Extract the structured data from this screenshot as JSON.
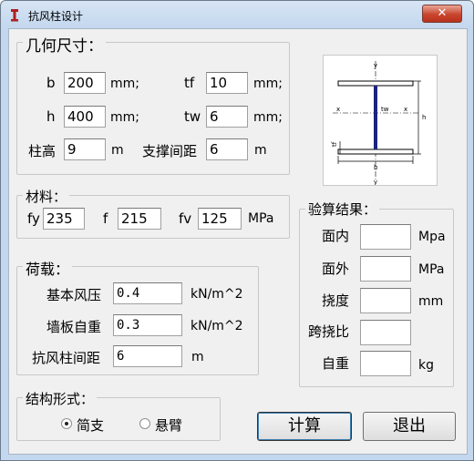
{
  "window": {
    "title": "抗风柱设计",
    "close_glyph": "✕"
  },
  "geometry_group": {
    "legend": "几何尺寸：",
    "fields": {
      "b": {
        "label": "b",
        "value": "200",
        "unit": "mm;"
      },
      "tf": {
        "label": "tf",
        "value": "10",
        "unit": "mm;"
      },
      "h": {
        "label": "h",
        "value": "400",
        "unit": "mm;"
      },
      "tw": {
        "label": "tw",
        "value": "6",
        "unit": "mm;"
      },
      "height": {
        "label": "柱高",
        "value": "9",
        "unit": "m"
      },
      "brace": {
        "label": "支撑间距",
        "value": "6",
        "unit": "m"
      }
    }
  },
  "diagram": {
    "y_top": "y",
    "y_bottom": "y",
    "x_left": "x",
    "x_right": "x",
    "tw": "tw",
    "tf": "tf",
    "h": "h",
    "b": "b"
  },
  "material_group": {
    "legend": "材料：",
    "fy": {
      "label": "fy",
      "value": "235"
    },
    "f": {
      "label": "f",
      "value": "215"
    },
    "fv": {
      "label": "fv",
      "value": "125"
    },
    "unit": "MPa"
  },
  "load_group": {
    "legend": "荷载：",
    "wind": {
      "label": "基本风压",
      "value": "0.4",
      "unit": "kN/m^2"
    },
    "wall": {
      "label": "墙板自重",
      "value": "0.3",
      "unit": "kN/m^2"
    },
    "spacing": {
      "label": "抗风柱间距",
      "value": "6",
      "unit": "m"
    }
  },
  "structure_group": {
    "legend": "结构形式：",
    "options": [
      {
        "label": "简支",
        "selected": true
      },
      {
        "label": "悬臂",
        "selected": false
      }
    ]
  },
  "result_group": {
    "legend": "验算结果：",
    "rows": [
      {
        "label": "面内",
        "value": "",
        "unit": "Mpa"
      },
      {
        "label": "面外",
        "value": "",
        "unit": "MPa"
      },
      {
        "label": "挠度",
        "value": "",
        "unit": "mm"
      },
      {
        "label": "跨挠比",
        "value": "",
        "unit": ""
      },
      {
        "label": "自重",
        "value": "",
        "unit": "kg"
      }
    ]
  },
  "buttons": {
    "calculate": "计算",
    "exit": "退出"
  },
  "colors": {
    "frame": "#c3d7ee",
    "client": "#f0f0f0",
    "close": "#c9452e",
    "section": "#1a237e"
  }
}
